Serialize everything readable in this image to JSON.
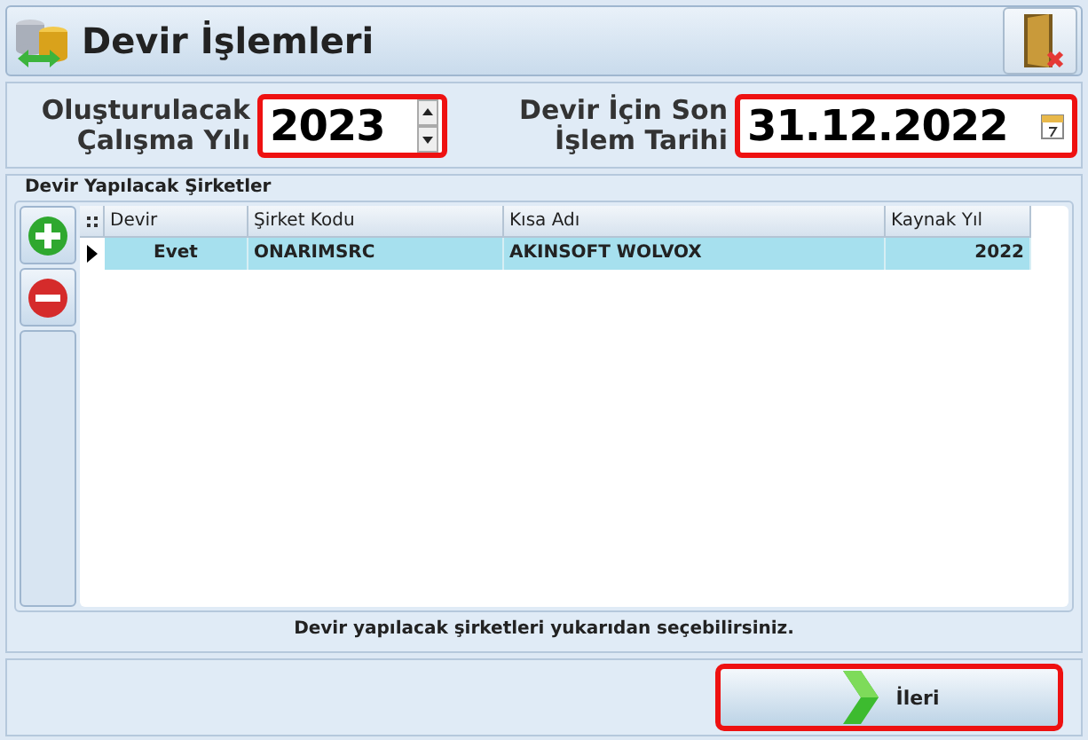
{
  "window": {
    "title": "Devir İşlemleri"
  },
  "form": [
    {
      "kind": "spin",
      "label": "Oluşturulacak Çalışma Yılı",
      "value": "2023",
      "highlighted": true
    },
    {
      "kind": "date",
      "label": "Devir İçin Son İşlem Tarihi",
      "value": "31.12.2022",
      "highlighted": true
    }
  ],
  "group": {
    "title": "Devir Yapılacak Şirketler",
    "table": {
      "columns": [
        "Devir",
        "Şirket Kodu",
        "Kısa Adı",
        "Kaynak Yıl"
      ],
      "rows": [
        {
          "cells": [
            "Evet",
            "ONARIMSRC",
            "AKINSOFT WOLVOX",
            "2022"
          ],
          "selected": true
        }
      ]
    },
    "hint": "Devir yapılacak şirketleri yukarıdan seçebilirsiniz."
  },
  "buttons": [
    {
      "label": "İleri",
      "highlighted": true
    }
  ]
}
